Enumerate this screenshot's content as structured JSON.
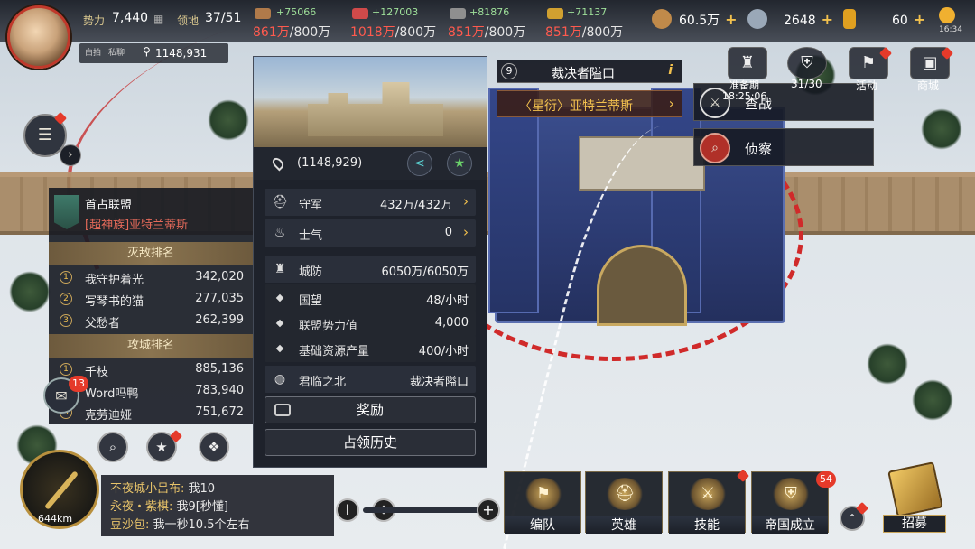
{
  "player": {
    "power_label": "势力",
    "power_value": "7,440",
    "territory_label": "领地",
    "territory_value": "37/51",
    "coords": "1148,931",
    "tag1": "白拍",
    "tag2": "私聊"
  },
  "resources": [
    {
      "name": "wood",
      "gain": "+75066",
      "used": "861万",
      "cap": "/800万",
      "color": "#b07a4a"
    },
    {
      "name": "iron",
      "gain": "+127003",
      "used": "1018万",
      "cap": "/800万",
      "color": "#d04a4a"
    },
    {
      "name": "stone",
      "gain": "+81876",
      "used": "851万",
      "cap": "/800万",
      "color": "#8f8f8f"
    },
    {
      "name": "grain",
      "gain": "+71137",
      "used": "851万",
      "cap": "/800万",
      "color": "#d0a030"
    }
  ],
  "currencies": [
    {
      "name": "copper-coin",
      "value": "60.5万",
      "color": "#c08a4a"
    },
    {
      "name": "silver-coin",
      "value": "2648",
      "color": "#9aa8b8"
    },
    {
      "name": "gold-ingot",
      "value": "60",
      "color": "#e0a020"
    }
  ],
  "clock": "16:34",
  "left_panel": {
    "title": "首占联盟",
    "alliance": "[超神族]亚特兰蒂斯",
    "kill_rank_title": "灭敌排名",
    "kill_rank": [
      {
        "rank": "1",
        "name": "我守护着光",
        "value": "342,020"
      },
      {
        "rank": "2",
        "name": "写琴书的猫",
        "value": "277,035"
      },
      {
        "rank": "3",
        "name": "父愁者",
        "value": "262,399"
      }
    ],
    "siege_rank_title": "攻城排名",
    "siege_rank": [
      {
        "rank": "1",
        "name": "千枝",
        "value": "885,136"
      },
      {
        "rank": "2",
        "name": "Word吗鸭",
        "value": "783,940"
      },
      {
        "rank": "3",
        "name": "克劳迪娅",
        "value": "751,672"
      }
    ]
  },
  "info_panel": {
    "coords": "(1148,929)",
    "garrison_label": "守军",
    "garrison_value": "432万/432万",
    "morale_label": "士气",
    "morale_value": "0",
    "defense_label": "城防",
    "defense_value": "6050万/6050万",
    "prestige_label": "国望",
    "prestige_value": "48/小时",
    "alliance_power_label": "联盟势力值",
    "alliance_power_value": "4,000",
    "base_res_label": "基础资源产量",
    "base_res_value": "400/小时",
    "region_label": "君临之北",
    "region_value": "裁决者隘口",
    "reward_button": "奖励",
    "history_button": "占领历史"
  },
  "fortress": {
    "level": "9",
    "name": "裁决者隘口",
    "owner": "〈星衍〉亚特兰蒂斯"
  },
  "actions": {
    "battle_label": "查战",
    "scout_label": "侦察"
  },
  "top_right": {
    "prep_label": "准备期",
    "prep_time": "18:25:06",
    "slots": "31/30",
    "events_label": "活动",
    "shop_label": "商城"
  },
  "mail_count": "13",
  "distance": "644km",
  "chat": [
    {
      "who": "不夜城小吕布:",
      "msg": " 我10"
    },
    {
      "who": "永夜・紫棋:",
      "msg": " 我9[秒懂]"
    },
    {
      "who": "豆沙包:",
      "msg": " 我一秒10.5个左右"
    }
  ],
  "bottom_nav": [
    {
      "label": "编队",
      "icon": "⚑"
    },
    {
      "label": "英雄",
      "icon": "⛑"
    },
    {
      "label": "技能",
      "icon": "⚔"
    },
    {
      "label": "帝国成立",
      "icon": "⛨",
      "badge": "54"
    }
  ],
  "recruit_label": "招募"
}
